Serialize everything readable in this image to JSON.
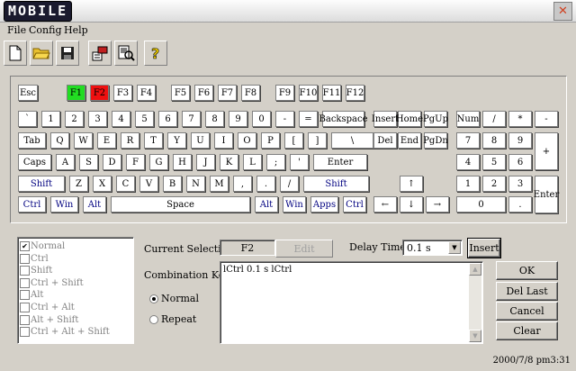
{
  "app": {
    "logo_text": "MOBILE",
    "close_glyph": "✕"
  },
  "menu": [
    "File",
    "Config",
    "Help"
  ],
  "toolbar": [
    "new-file-icon",
    "open-folder-icon",
    "save-disk-icon",
    "send-phone-icon",
    "preview-zoom-icon",
    "help-question-icon"
  ],
  "keyboard": {
    "pressed_green": "F1",
    "pressed_red": "F2",
    "rows": {
      "fn": [
        "Esc",
        "F1",
        "F2",
        "F3",
        "F4",
        "F5",
        "F6",
        "F7",
        "F8",
        "F9",
        "F10",
        "F11",
        "F12"
      ],
      "num": [
        "`",
        "1",
        "2",
        "3",
        "4",
        "5",
        "6",
        "7",
        "8",
        "9",
        "0",
        "-",
        "=",
        "Backspace"
      ],
      "tab": [
        "Tab",
        "Q",
        "W",
        "E",
        "R",
        "T",
        "Y",
        "U",
        "I",
        "O",
        "P",
        "[",
        "]",
        "\\"
      ],
      "caps": [
        "Caps",
        "A",
        "S",
        "D",
        "F",
        "G",
        "H",
        "J",
        "K",
        "L",
        ";",
        "'",
        "Enter"
      ],
      "shift": [
        "Shift",
        "Z",
        "X",
        "C",
        "V",
        "B",
        "N",
        "M",
        ",",
        ".",
        "/",
        "Shift"
      ],
      "ctrl": [
        "Ctrl",
        "Win",
        "Alt",
        "Space",
        "Alt",
        "Win",
        "Apps",
        "Ctrl"
      ]
    },
    "nav": [
      "Insert",
      "Home",
      "PgUp",
      "Del",
      "End",
      "PgDn"
    ],
    "arrows": [
      "↑",
      "←",
      "↓",
      "→"
    ],
    "numpad": [
      "Num",
      "/",
      "*",
      "-",
      "7",
      "8",
      "9",
      "+",
      "4",
      "5",
      "6",
      "1",
      "2",
      "3",
      "Enter",
      "0",
      "."
    ]
  },
  "combo_list": [
    "Normal",
    "Ctrl",
    "Shift",
    "Ctrl + Shift",
    "Alt",
    "Ctrl + Alt",
    "Alt + Shift",
    "Ctrl + Alt + Shift"
  ],
  "current_selection": {
    "label": "Current Selection",
    "value": "F2",
    "edit_label": "Edit"
  },
  "delay": {
    "label": "Delay Time :",
    "value": "0.1 s",
    "insert_label": "Insert"
  },
  "combination": {
    "label": "Combination Key",
    "normal": "Normal",
    "repeat": "Repeat"
  },
  "script_text": "lCtrl  0.1 s lCtrl",
  "buttons": {
    "ok": "OK",
    "del_last": "Del Last",
    "cancel": "Cancel",
    "clear": "Clear"
  },
  "status": "2000/7/8 pm3:31"
}
